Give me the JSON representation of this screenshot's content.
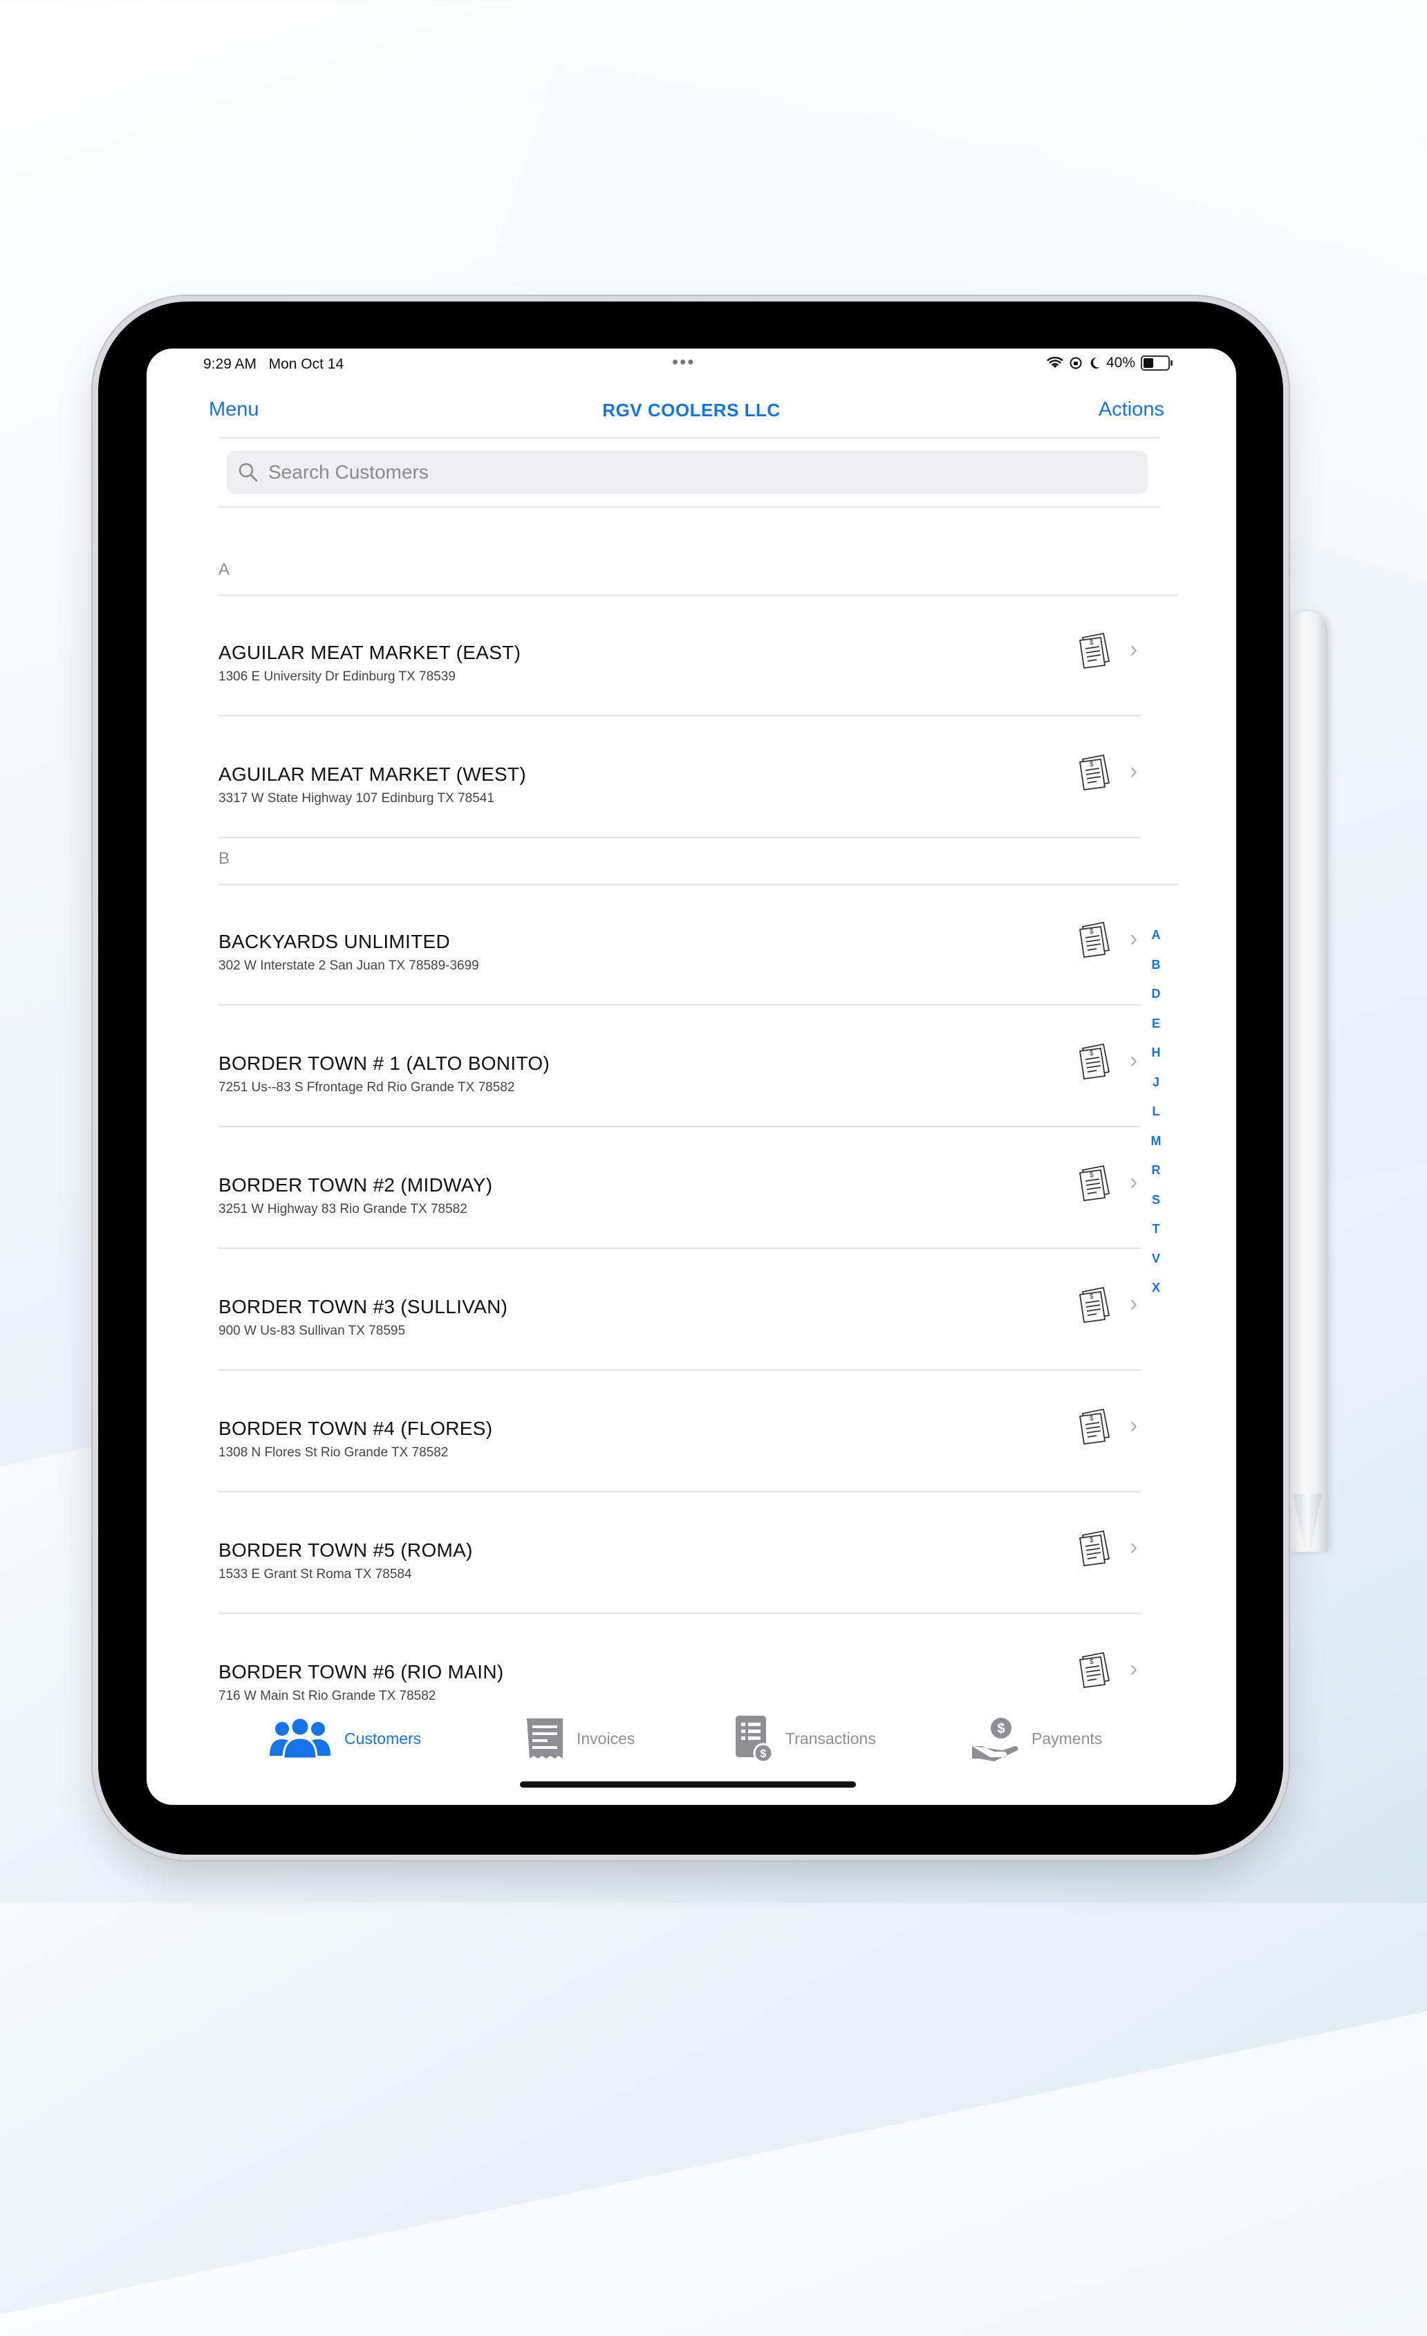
{
  "status_bar": {
    "time": "9:29 AM",
    "date": "Mon Oct 14",
    "dots": "•••",
    "battery_label": "40%",
    "battery_level": 0.4
  },
  "nav": {
    "menu_label": "Menu",
    "title": "RGV COOLERS LLC",
    "actions_label": "Actions"
  },
  "search": {
    "placeholder": "Search Customers",
    "value": ""
  },
  "sections": [
    {
      "letter": "A",
      "customers": [
        {
          "name": "AGUILAR MEAT MARKET (EAST)",
          "address": "1306 E University Dr  Edinburg TX 78539"
        },
        {
          "name": "AGUILAR MEAT MARKET (WEST)",
          "address": "3317 W State Highway 107  Edinburg TX 78541"
        }
      ]
    },
    {
      "letter": "B",
      "customers": [
        {
          "name": "BACKYARDS UNLIMITED",
          "address": "302 W Interstate 2  San Juan TX 78589-3699"
        },
        {
          "name": "BORDER TOWN # 1 (ALTO BONITO)",
          "address": "7251 Us--83 S Ffrontage Rd  Rio Grande TX 78582"
        },
        {
          "name": "BORDER TOWN #2 (MIDWAY)",
          "address": "3251 W Highway 83  Rio Grande TX 78582"
        },
        {
          "name": "BORDER TOWN #3 (SULLIVAN)",
          "address": "900 W Us-83  Sullivan TX 78595"
        },
        {
          "name": "BORDER TOWN #4 (FLORES)",
          "address": "1308 N Flores St  Rio Grande TX 78582"
        },
        {
          "name": "BORDER TOWN #5 (ROMA)",
          "address": "1533 E Grant St  Roma TX 78584"
        },
        {
          "name": "BORDER TOWN #6 (RIO MAIN)",
          "address": "716 W Main St  Rio Grande TX 78582"
        }
      ]
    }
  ],
  "index_letters": [
    "A",
    "B",
    "D",
    "E",
    "H",
    "J",
    "L",
    "M",
    "R",
    "S",
    "T",
    "V",
    "X"
  ],
  "tabs": [
    {
      "label": "Customers",
      "icon": "customers-icon",
      "active": true
    },
    {
      "label": "Invoices",
      "icon": "invoices-icon",
      "active": false
    },
    {
      "label": "Transactions",
      "icon": "transactions-icon",
      "active": false
    },
    {
      "label": "Payments",
      "icon": "payments-icon",
      "active": false
    }
  ],
  "colors": {
    "accent": "#1473e6",
    "inactive": "#8e8e93"
  }
}
